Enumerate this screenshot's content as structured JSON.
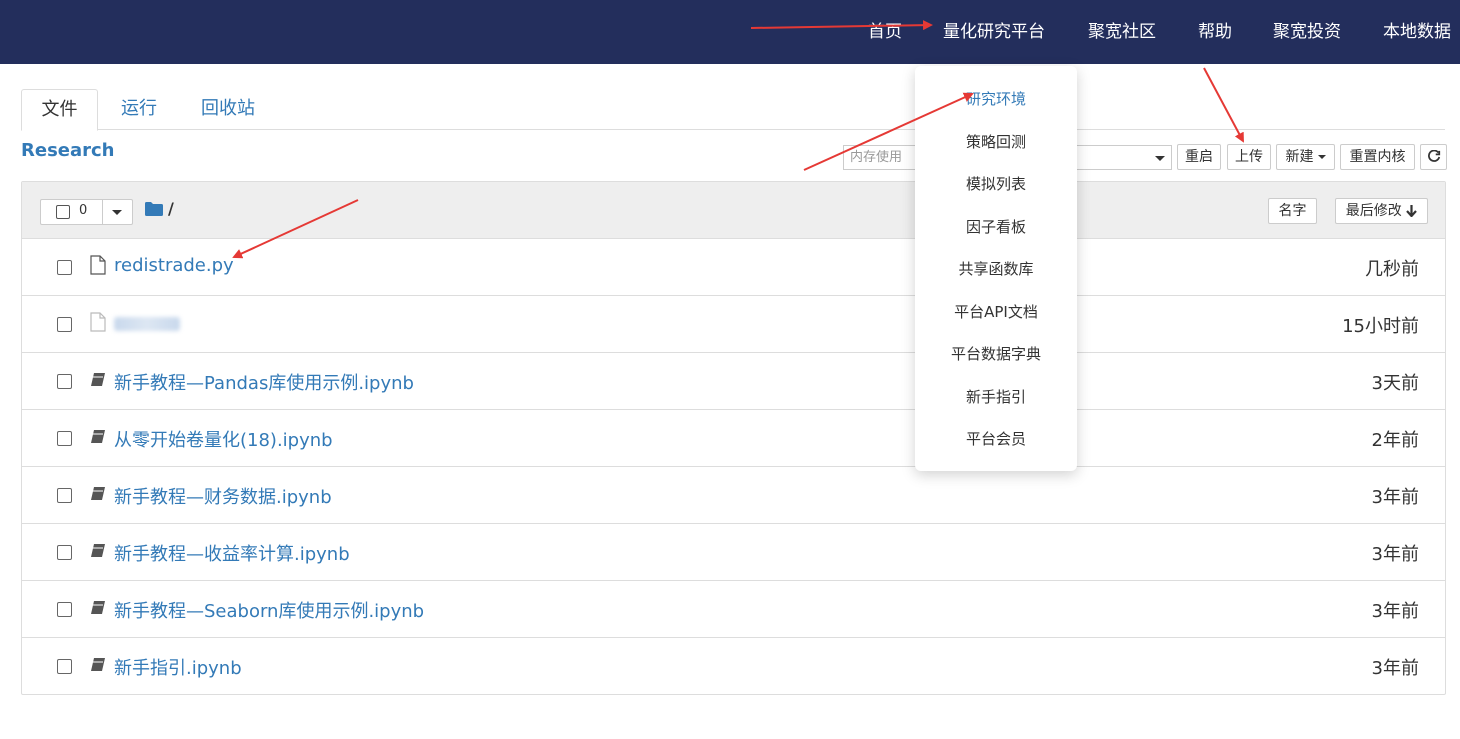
{
  "topnav": {
    "items": [
      "首页",
      "量化研究平台",
      "聚宽社区",
      "帮助",
      "聚宽投资",
      "本地数据"
    ]
  },
  "tabs": [
    "文件",
    "运行",
    "回收站"
  ],
  "research_title": "Research",
  "toolbar": {
    "memory_placeholder": "内存使用",
    "restart": "重启",
    "upload": "上传",
    "new": "新建",
    "reset_kernel": "重置内核",
    "refresh_icon": "refresh-icon"
  },
  "list_header": {
    "selected_count": "0",
    "path": "/",
    "sort_name": "名字",
    "sort_modified": "最后修改"
  },
  "files": [
    {
      "name": "redistrade.py",
      "type": "file",
      "modified": "几秒前"
    },
    {
      "name": "",
      "type": "file",
      "modified": "15小时前",
      "blurred": true
    },
    {
      "name": "新手教程—Pandas库使用示例.ipynb",
      "type": "notebook",
      "modified": "3天前"
    },
    {
      "name": "从零开始卷量化(18).ipynb",
      "type": "notebook",
      "modified": "2年前"
    },
    {
      "name": "新手教程—财务数据.ipynb",
      "type": "notebook",
      "modified": "3年前"
    },
    {
      "name": "新手教程—收益率计算.ipynb",
      "type": "notebook",
      "modified": "3年前"
    },
    {
      "name": "新手教程—Seaborn库使用示例.ipynb",
      "type": "notebook",
      "modified": "3年前"
    },
    {
      "name": "新手指引.ipynb",
      "type": "notebook",
      "modified": "3年前"
    }
  ],
  "dropdown": {
    "items": [
      "研究环境",
      "策略回测",
      "模拟列表",
      "因子看板",
      "共享函数库",
      "平台API文档",
      "平台数据字典",
      "新手指引",
      "平台会员"
    ]
  },
  "colors": {
    "nav_bg": "#232e5c",
    "link": "#337ab7",
    "annotation_arrow": "#e53935"
  }
}
